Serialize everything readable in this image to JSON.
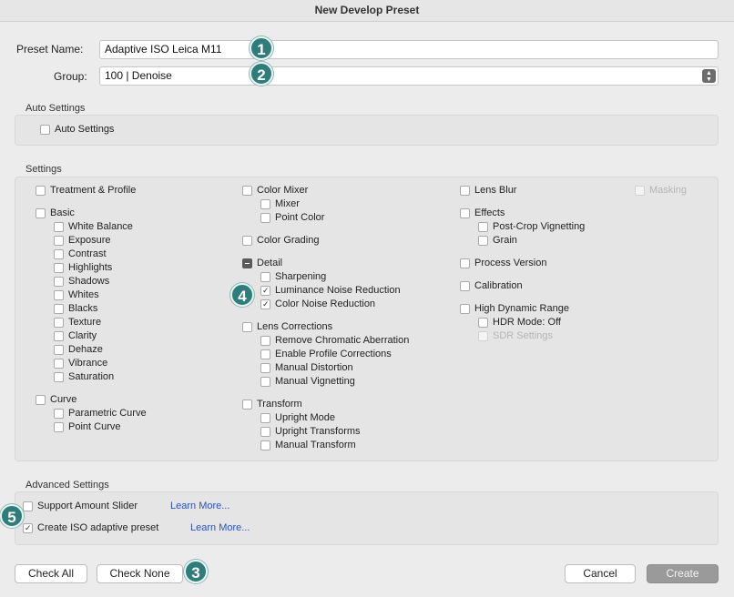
{
  "window": {
    "title": "New Develop Preset"
  },
  "preset_name": {
    "label": "Preset Name:",
    "value": "Adaptive ISO Leica M11"
  },
  "group": {
    "label": "Group:",
    "value": "100 | Denoise"
  },
  "auto_settings": {
    "title": "Auto Settings",
    "item": "Auto Settings"
  },
  "settings": {
    "title": "Settings",
    "treatment_profile": "Treatment & Profile",
    "basic": "Basic",
    "basic_items": [
      "White Balance",
      "Exposure",
      "Contrast",
      "Highlights",
      "Shadows",
      "Whites",
      "Blacks",
      "Texture",
      "Clarity",
      "Dehaze",
      "Vibrance",
      "Saturation"
    ],
    "curve": "Curve",
    "curve_items": [
      "Parametric Curve",
      "Point Curve"
    ],
    "color_mixer": "Color Mixer",
    "color_mixer_items": [
      "Mixer",
      "Point Color"
    ],
    "color_grading": "Color Grading",
    "detail": "Detail",
    "detail_items": [
      "Sharpening",
      "Luminance Noise Reduction",
      "Color Noise Reduction"
    ],
    "lens_corrections": "Lens Corrections",
    "lens_items": [
      "Remove Chromatic Aberration",
      "Enable Profile Corrections",
      "Manual Distortion",
      "Manual Vignetting"
    ],
    "transform": "Transform",
    "transform_items": [
      "Upright Mode",
      "Upright Transforms",
      "Manual Transform"
    ],
    "lens_blur": "Lens Blur",
    "masking": "Masking",
    "effects": "Effects",
    "effects_items": [
      "Post-Crop Vignetting",
      "Grain"
    ],
    "process_version": "Process Version",
    "calibration": "Calibration",
    "hdr": "High Dynamic Range",
    "hdr_items": [
      "HDR Mode: Off",
      "SDR Settings"
    ]
  },
  "advanced": {
    "title": "Advanced Settings",
    "support_amount": "Support Amount Slider",
    "iso_adaptive": "Create ISO adaptive preset",
    "learn_more": "Learn More..."
  },
  "buttons": {
    "check_all": "Check All",
    "check_none": "Check None",
    "cancel": "Cancel",
    "create": "Create"
  },
  "badges": [
    "1",
    "2",
    "3",
    "4",
    "5"
  ],
  "colors": {
    "badge": "#2f7d7a",
    "link": "#2a52be",
    "create_button": "#9a9a9a"
  }
}
